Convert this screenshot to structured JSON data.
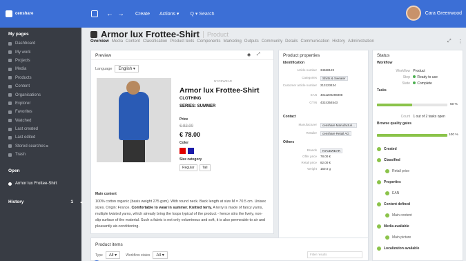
{
  "topbar": {
    "logo": "censhare",
    "create": "Create",
    "actions": "Actions ▾",
    "search": "Q ▾ Search",
    "user": "Cara Greenwood",
    "accent": "#3c6fd6"
  },
  "sidebar": {
    "heading": "My pages",
    "items": [
      "Dashboard",
      "My work",
      "Projects",
      "Media",
      "Products",
      "Content",
      "Organisations",
      "Explorer",
      "Favorites",
      "Watched",
      "Last created",
      "Last edited",
      "Stored searches ▸",
      "Trash"
    ],
    "open_heading": "Open",
    "open_item": "Armor lux Frottee-Shirt",
    "history_heading": "History",
    "history_count": "1"
  },
  "page": {
    "title": "Armor lux Frottee-Shirt",
    "type": "Product",
    "tabs": [
      "Overview",
      "Media",
      "Content",
      "Classification",
      "Product texts",
      "Components",
      "Marketing",
      "Outputs",
      "Community",
      "Details",
      "Communication",
      "History",
      "Administration"
    ]
  },
  "preview": {
    "title": "Preview",
    "language_label": "Language",
    "language": "English",
    "brand": "NYCEWEAR",
    "name": "Armor lux Frottee-Shirt",
    "category": "CLOTHING",
    "series": "SERIES: SUMMER",
    "price_label": "Price",
    "old_price": "€ 82.00",
    "price": "€ 78.00",
    "color_label": "Color",
    "colors": [
      "#e00000",
      "#1a1aa8"
    ],
    "size_label": "Size category",
    "sizes": [
      "Regular",
      "Tall"
    ],
    "main_content_label": "Main content",
    "text_a": "100% cotton organic (basis weight 275 gsm). With round neck. Back length at size M = 70.5 cm. Unisex sizes. Origin: France. ",
    "text_bold_a": "Comfortable to wear in summer. Knitted terry.",
    "text_b": " A terry is made of fancy yarns, multiple twisted yarns, which already bring the loops typical of the product - hence stirs the lively, non-slip surface of the material. Such a fabric is not only voluminous and soft, it is also permeable to air and pleasantly air-conditioning."
  },
  "properties": {
    "title": "Product properties",
    "identification": "Identification",
    "rows_a": [
      {
        "k": "Article number",
        "v": "34568123"
      },
      {
        "k": "Categories",
        "v": "Shirts & Sweater"
      },
      {
        "k": "Customer article number",
        "v": "213123434"
      },
      {
        "k": "EAN",
        "v": "4011200296908"
      },
      {
        "k": "GTIN",
        "v": "4324354543"
      }
    ],
    "contact": "Contact",
    "rows_b": [
      {
        "k": "Manufacturer",
        "v": "censhare Manufacturi..."
      },
      {
        "k": "Retailer",
        "v": "censhare Retail AG"
      }
    ],
    "others": "Others",
    "rows_c": [
      {
        "k": "Brands",
        "v": "NYCEWEAR"
      },
      {
        "k": "Offer price",
        "v": "78.00 €"
      },
      {
        "k": "Retail price",
        "v": "82.00 €"
      },
      {
        "k": "Weight",
        "v": "150.0 g"
      }
    ]
  },
  "status": {
    "title": "Status",
    "workflow": "Workflow",
    "wf_label": "Workflow",
    "wf_value": "Product",
    "step_label": "Step",
    "step_value": "Ready to use",
    "state_label": "State",
    "state_value": "Complete",
    "tasks": "Tasks",
    "tasks_pct": "50 %",
    "tasks_progress": 0.5,
    "count_label": "Count",
    "count_value": "1 out of 2 tasks open",
    "gates": "Browse quality gates",
    "gates_pct": "100 %",
    "gates_progress": 1.0,
    "gate_items": [
      {
        "label": "Created",
        "sub": false
      },
      {
        "label": "Classified",
        "sub": false
      },
      {
        "label": "Retail price",
        "sub": true
      },
      {
        "label": "Properties",
        "sub": false
      },
      {
        "label": "EAN",
        "sub": true
      },
      {
        "label": "Content defined",
        "sub": false
      },
      {
        "label": "Main content",
        "sub": true
      },
      {
        "label": "Media available",
        "sub": false
      },
      {
        "label": "Main picture",
        "sub": true
      },
      {
        "label": "Localization available",
        "sub": false
      }
    ]
  },
  "items": {
    "title": "Product items",
    "type_label": "Type",
    "type_value": "All",
    "wf_label": "Workflow states",
    "wf_value": "All",
    "filter_placeholder": "Filter results"
  }
}
